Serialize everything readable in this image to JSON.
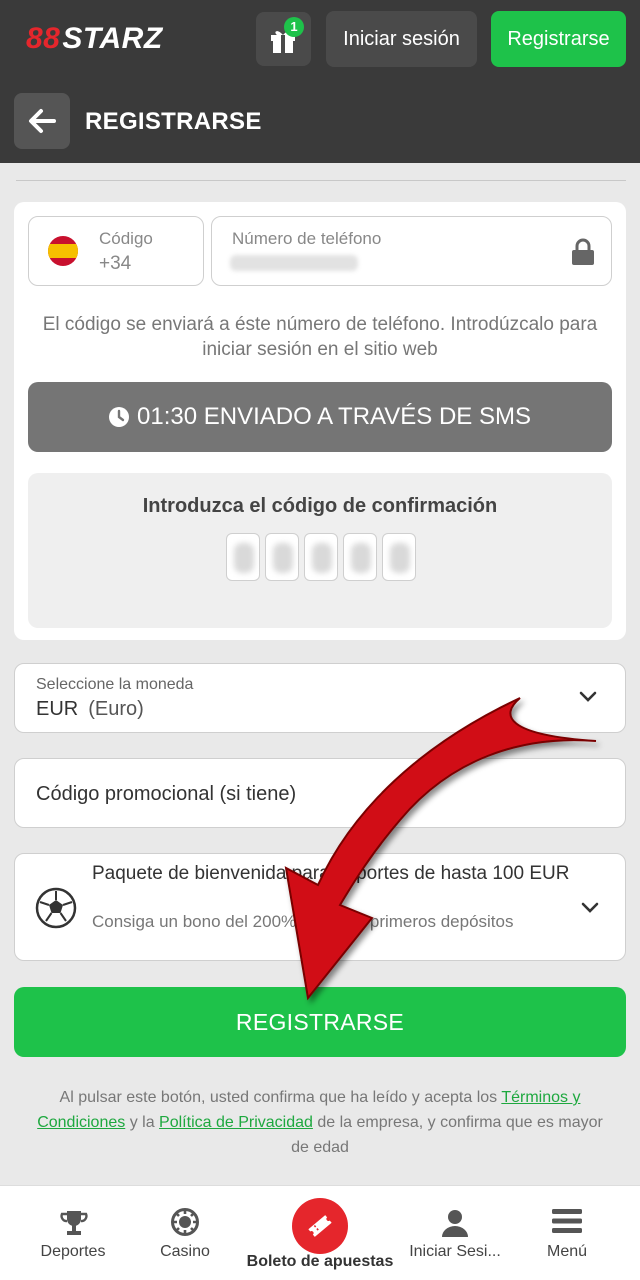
{
  "header": {
    "logo_prefix": "88",
    "logo_text": "STARZ",
    "gift_badge": "1",
    "login_label": "Iniciar sesión",
    "register_label": "Registrarse"
  },
  "subheader": {
    "title": "REGISTRARSE"
  },
  "phone": {
    "code_label": "Código",
    "code_value": "+34",
    "phone_label": "Número de teléfono",
    "info_text": "El código se enviará a éste número de teléfono. Introdúzcalo para iniciar sesión en el sitio web",
    "sms_timer": "01:30",
    "sms_label": "ENVIADO A TRAVÉS DE SMS"
  },
  "confirmation": {
    "title": "Introduzca el código de confirmación"
  },
  "currency": {
    "label": "Seleccione la moneda",
    "code": "EUR",
    "name": "(Euro)"
  },
  "promo": {
    "placeholder": "Código promocional (si tiene)"
  },
  "bonus": {
    "title": "Paquete de bienvenida para deportes de hasta 100 EUR",
    "description": "Consiga un bono del 200% en sus 4 primeros depósitos"
  },
  "submit": {
    "label": "REGISTRARSE"
  },
  "legal": {
    "text_1": "Al pulsar este botón, usted confirma que ha leído y acepta los ",
    "terms_link": "Términos y Condiciones",
    "text_2": " y la ",
    "privacy_link": "Política de Privacidad",
    "text_3": " de la empresa, y confirma que es mayor de edad"
  },
  "bottom_nav": {
    "sports": "Deportes",
    "casino": "Casino",
    "betslip": "Boleto de apuestas",
    "login": "Iniciar Sesi...",
    "menu": "Menú"
  },
  "colors": {
    "brand_green": "#1ec24a",
    "brand_red": "#e5262c",
    "header_bg": "#3a3a3a",
    "annotation_arrow": "#d10f14"
  }
}
